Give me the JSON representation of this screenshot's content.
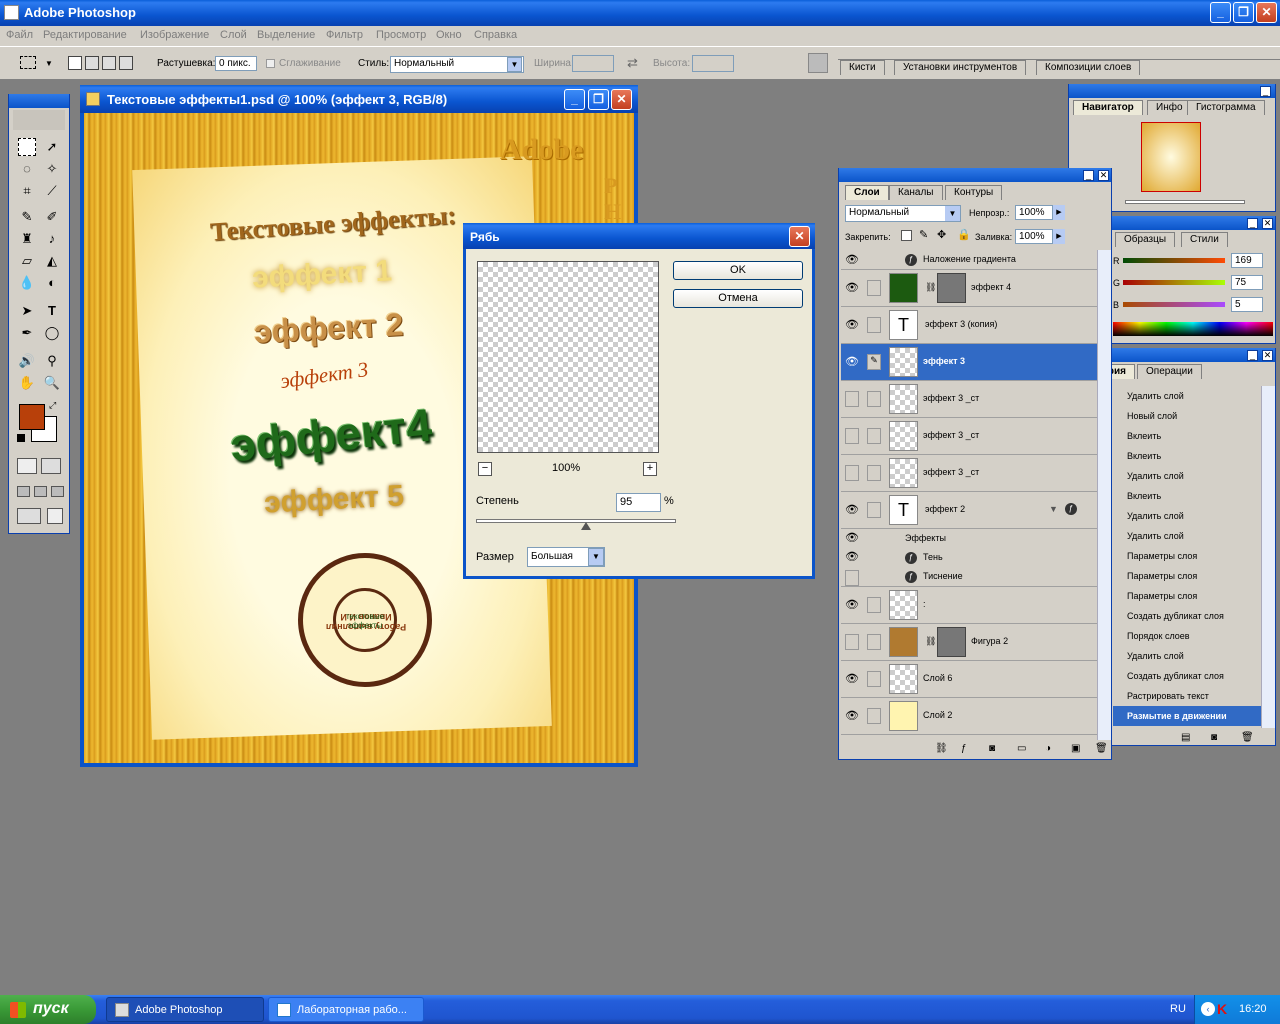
{
  "app": {
    "title": "Adobe Photoshop"
  },
  "menu": [
    "Файл",
    "Редактирование",
    "Изображение",
    "Слой",
    "Выделение",
    "Фильтр",
    "Просмотр",
    "Окно",
    "Справка"
  ],
  "options": {
    "feather_label": "Растушевка:",
    "feather_value": "0 пикс.",
    "antialias_label": "Сглаживание",
    "style_label": "Стиль:",
    "style_value": "Нормальный",
    "width_label": "Ширина:",
    "height_label": "Высота:"
  },
  "palette_well": [
    "Кисти",
    "Установки инструментов",
    "Композиции слоев"
  ],
  "document": {
    "title": "Текстовые эффекты1.psd @ 100% (эффект 3, RGB/8)",
    "heading": "Текстовые эффекты:",
    "e1": "эффект 1",
    "e2": "эффект 2",
    "e3": "эффект 3",
    "e4": "эффект4",
    "e5": "эффект 5",
    "adobe": "Adobe",
    "side": "Р Н",
    "stamp_outer": "Работу выполнил Иванов И.И",
    "stamp_inner": "текстовые эффекты"
  },
  "dialog": {
    "title": "Рябь",
    "ok": "OK",
    "cancel": "Отмена",
    "zoom": "100%",
    "amount_label": "Степень",
    "amount_value": "95",
    "percent": "%",
    "size_label": "Размер",
    "size_value": "Большая",
    "minus": "−",
    "plus": "+",
    "amount_pos": 0.55
  },
  "navigator": {
    "tabs": [
      "Навигатор",
      "Инфо",
      "Гистограмма"
    ]
  },
  "color": {
    "tabs": [
      "Образцы",
      "Стили"
    ],
    "r_label": "R",
    "g_label": "G",
    "b_label": "B",
    "r": "169",
    "g": "75",
    "b": "5"
  },
  "history": {
    "tabs": [
      "История",
      "Операции"
    ],
    "items": [
      "Удалить слой",
      "Новый слой",
      "Вклеить",
      "Вклеить",
      "Удалить слой",
      "Вклеить",
      "Удалить слой",
      "Удалить слой",
      "Параметры слоя",
      "Параметры слоя",
      "Параметры слоя",
      "Создать дубликат слоя",
      "Порядок слоев",
      "Удалить слой",
      "Создать дубликат слоя",
      "Растрировать текст",
      "Размытие в движении"
    ]
  },
  "layers": {
    "tabs": [
      "Слои",
      "Каналы",
      "Контуры"
    ],
    "blend": "Нормальный",
    "opacity_label": "Непрозр.:",
    "opacity": "100%",
    "lock_label": "Закрепить:",
    "fill_label": "Заливка:",
    "fill": "100%",
    "rows": [
      "Наложение градиента",
      "эффект 4",
      "эффект 3 (копия)",
      "эффект 3",
      "эффект 3 _ст",
      "эффект 3 _ст",
      "эффект 3 _ст",
      "эффект 2",
      "Эффекты",
      "Тень",
      "Тиснение",
      ":",
      "Фигура 2",
      "Слой 6",
      "Слой 2"
    ]
  },
  "taskbar": {
    "start": "пуск",
    "tasks": [
      "Adobe Photoshop",
      "Лабораторная рабо..."
    ],
    "lang": "RU",
    "time": "16:20"
  },
  "colors": {
    "fg": "#b8400a",
    "accent": "#316ac5"
  }
}
